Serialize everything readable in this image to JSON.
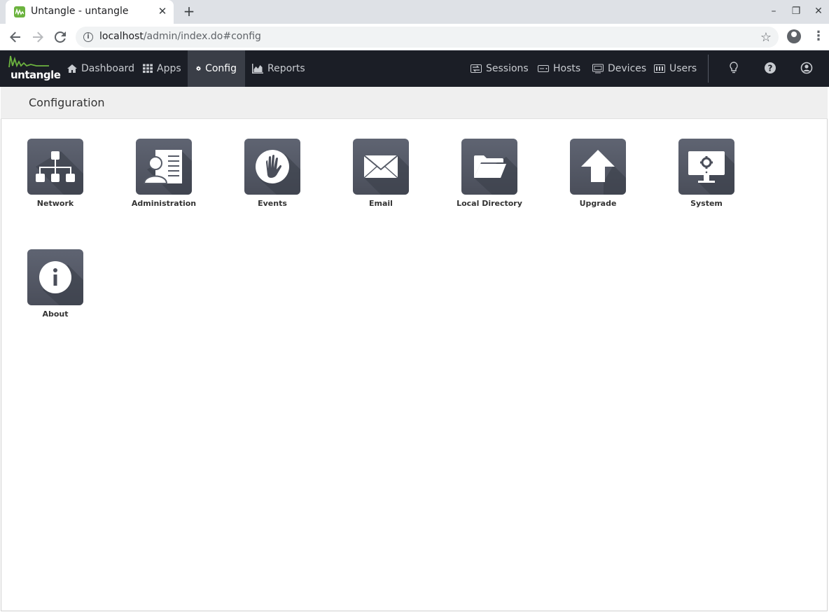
{
  "browser": {
    "tab_title": "Untangle - untangle",
    "url_host": "localhost",
    "url_path": "/admin/index.do#config"
  },
  "nav": {
    "logo_text": "untangle",
    "items": [
      {
        "label": "Dashboard",
        "icon": "home-icon"
      },
      {
        "label": "Apps",
        "icon": "grid-icon"
      },
      {
        "label": "Config",
        "icon": "gear-icon",
        "active": true
      },
      {
        "label": "Reports",
        "icon": "area-chart-icon"
      }
    ],
    "right_items": [
      {
        "label": "Sessions",
        "icon": "exchange-icon"
      },
      {
        "label": "Hosts",
        "icon": "hdd-icon"
      },
      {
        "label": "Devices",
        "icon": "monitor-icon"
      },
      {
        "label": "Users",
        "icon": "users-icon"
      }
    ],
    "tools": [
      "lightbulb-icon",
      "help-icon",
      "account-icon"
    ]
  },
  "page": {
    "title": "Configuration"
  },
  "config_items": [
    {
      "label": "Network",
      "icon": "network-icon"
    },
    {
      "label": "Administration",
      "icon": "administration-icon"
    },
    {
      "label": "Events",
      "icon": "events-icon"
    },
    {
      "label": "Email",
      "icon": "email-icon"
    },
    {
      "label": "Local Directory",
      "icon": "folder-icon"
    },
    {
      "label": "Upgrade",
      "icon": "upgrade-icon"
    },
    {
      "label": "System",
      "icon": "system-icon"
    },
    {
      "label": "About",
      "icon": "about-icon"
    }
  ],
  "colors": {
    "nav_bg": "#1b1e26",
    "nav_active": "#3a3e47",
    "brand_green": "#6cb33f",
    "icon_tile": "#565b67"
  }
}
